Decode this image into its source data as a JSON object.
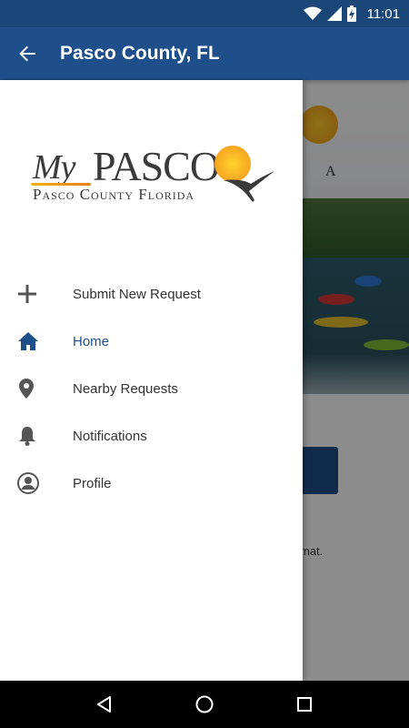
{
  "status_bar": {
    "time": "11:01",
    "icons": [
      "wifi-icon",
      "signal-icon",
      "battery-charging-icon"
    ]
  },
  "app_bar": {
    "title": "Pasco County, FL",
    "back_icon": "arrow-back-icon",
    "color": "#1f4f8b"
  },
  "drawer": {
    "logo": {
      "my": "My",
      "pasco": "PASCO",
      "subtitle": "Pasco County Florida"
    },
    "menu": [
      {
        "label": "Submit New Request",
        "icon": "plus-icon"
      },
      {
        "label": "Home",
        "icon": "home-icon",
        "active": true
      },
      {
        "label": "Nearby Requests",
        "icon": "map-pin-icon"
      },
      {
        "label": "Notifications",
        "icon": "bell-icon"
      },
      {
        "label": "Profile",
        "icon": "profile-icon"
      }
    ],
    "active_color": "#1f4f8b"
  },
  "background": {
    "logo_letter": "A",
    "text_fragment": "mat."
  },
  "nav_bar": {
    "buttons": [
      "back-triangle-icon",
      "home-circle-icon",
      "recents-square-icon"
    ]
  }
}
